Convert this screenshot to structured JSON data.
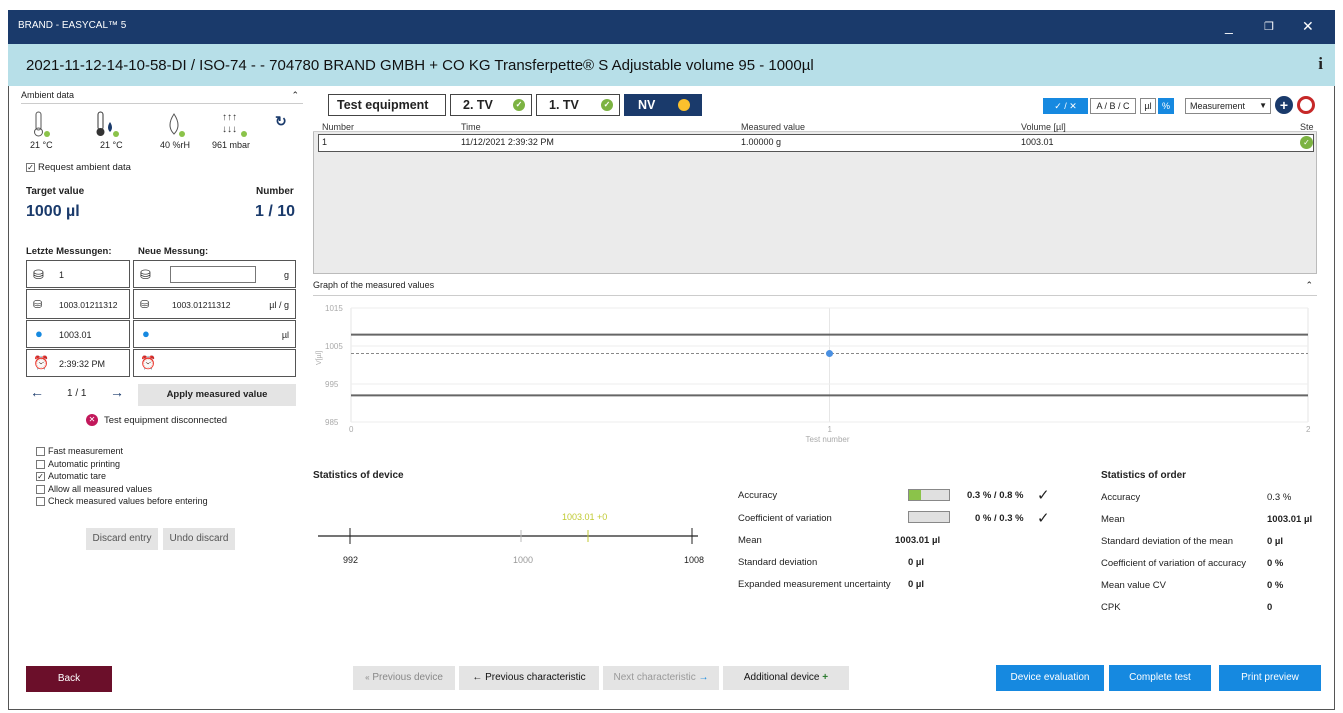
{
  "window": {
    "title": "BRAND - EASYCAL™ 5",
    "minimize": "_",
    "restore": "❐",
    "close": "✕"
  },
  "header": {
    "title": "2021-11-12-14-10-58-DI / ISO-74 -  - 704780 BRAND GMBH + CO KG Transferpette® S Adjustable volume 95 - 1000µl",
    "info": "i"
  },
  "left": {
    "ambient_label": "Ambient data",
    "ambient": [
      {
        "value": "21 °C"
      },
      {
        "value": "21 °C"
      },
      {
        "value": "40 %rH"
      },
      {
        "value": "961 mbar"
      }
    ],
    "request_ambient": "Request ambient data",
    "target_label": "Target value",
    "target_value": "1000 µl",
    "number_label": "Number",
    "number_value": "1 / 10",
    "last_label": "Letzte Messungen:",
    "new_label": "Neue Messung:",
    "last_rows": [
      "1",
      "1003.01211312",
      "1003.01",
      "2:39:32 PM"
    ],
    "new_rows": [
      {
        "value": "",
        "unit": "g"
      },
      {
        "value": "1003.01211312",
        "unit": "µl / g"
      },
      {
        "value": "",
        "unit": "µl"
      },
      {
        "value": "",
        "unit": ""
      }
    ],
    "pager": "1 / 1",
    "apply": "Apply measured value",
    "disconnected": "Test equipment disconnected",
    "options": [
      {
        "label": "Fast measurement",
        "checked": false
      },
      {
        "label": "Automatic printing",
        "checked": false
      },
      {
        "label": "Automatic tare",
        "checked": true
      },
      {
        "label": "Allow all measured values",
        "checked": false
      },
      {
        "label": "Check measured values before entering",
        "checked": false
      }
    ],
    "discard": "Discard entry",
    "undo": "Undo discard"
  },
  "steps": {
    "s1": "Test equipment",
    "s2": "2. TV",
    "s3": "1. TV",
    "s4": "NV"
  },
  "toolbar": {
    "check": "✓ / ✕",
    "abc": "A / B / C",
    "ul": "µl",
    "pct": "%",
    "mode": "Measurement"
  },
  "table": {
    "headers": [
      "Number",
      "Time",
      "Measured value",
      "Volume [µl]",
      "Ste"
    ],
    "rows": [
      [
        "1",
        "11/12/2021 2:39:32 PM",
        "1.00000 g",
        "1003.01"
      ]
    ]
  },
  "graph": {
    "title": "Graph of the measured values",
    "ylabel": "V[µl]",
    "xlabel": "Test number"
  },
  "chart_data": {
    "type": "line",
    "title": "Graph of the measured values",
    "xlabel": "Test number",
    "ylabel": "V[µl]",
    "ylim": [
      985,
      1015
    ],
    "xlim": [
      0,
      2
    ],
    "yticks": [
      "1015",
      "1005",
      "995",
      "985"
    ],
    "xticks": [
      "0",
      "1",
      "2"
    ],
    "series": [
      {
        "x": [
          1
        ],
        "y": [
          1003.01
        ]
      }
    ],
    "upper_limit": 1008,
    "lower_limit": 992,
    "mean_line": 1003.01
  },
  "device": {
    "title": "Statistics of device",
    "scale": [
      "992",
      "1000",
      "1008"
    ],
    "mean_marker": "1003.01 +0",
    "rows": [
      {
        "label": "Accuracy",
        "value": "0.3 % / 0.8 %",
        "bar": 0.3
      },
      {
        "label": "Coefficient of variation",
        "value": "0 % / 0.3 %",
        "bar": 0
      },
      {
        "label": "Mean",
        "value": "1003.01 µl"
      },
      {
        "label": "Standard deviation",
        "value": "0 µl"
      },
      {
        "label": "Expanded measurement uncertainty",
        "value": "0 µl"
      }
    ]
  },
  "order": {
    "title": "Statistics of order",
    "rows": [
      {
        "label": "Accuracy",
        "value": "0.3 %"
      },
      {
        "label": "Mean",
        "value": "1003.01 µl"
      },
      {
        "label": "Standard deviation of the mean",
        "value": "0 µl"
      },
      {
        "label": "Coefficient of variation of accuracy",
        "value": "0 %"
      },
      {
        "label": "Mean value CV",
        "value": "0 %"
      },
      {
        "label": "CPK",
        "value": "0"
      }
    ]
  },
  "footer": {
    "back": "Back",
    "prev_device": "Previous device",
    "prev_char": "Previous characteristic",
    "next_char": "Next characteristic",
    "add_device": "Additional device",
    "eval": "Device evaluation",
    "complete": "Complete test",
    "print": "Print preview"
  }
}
